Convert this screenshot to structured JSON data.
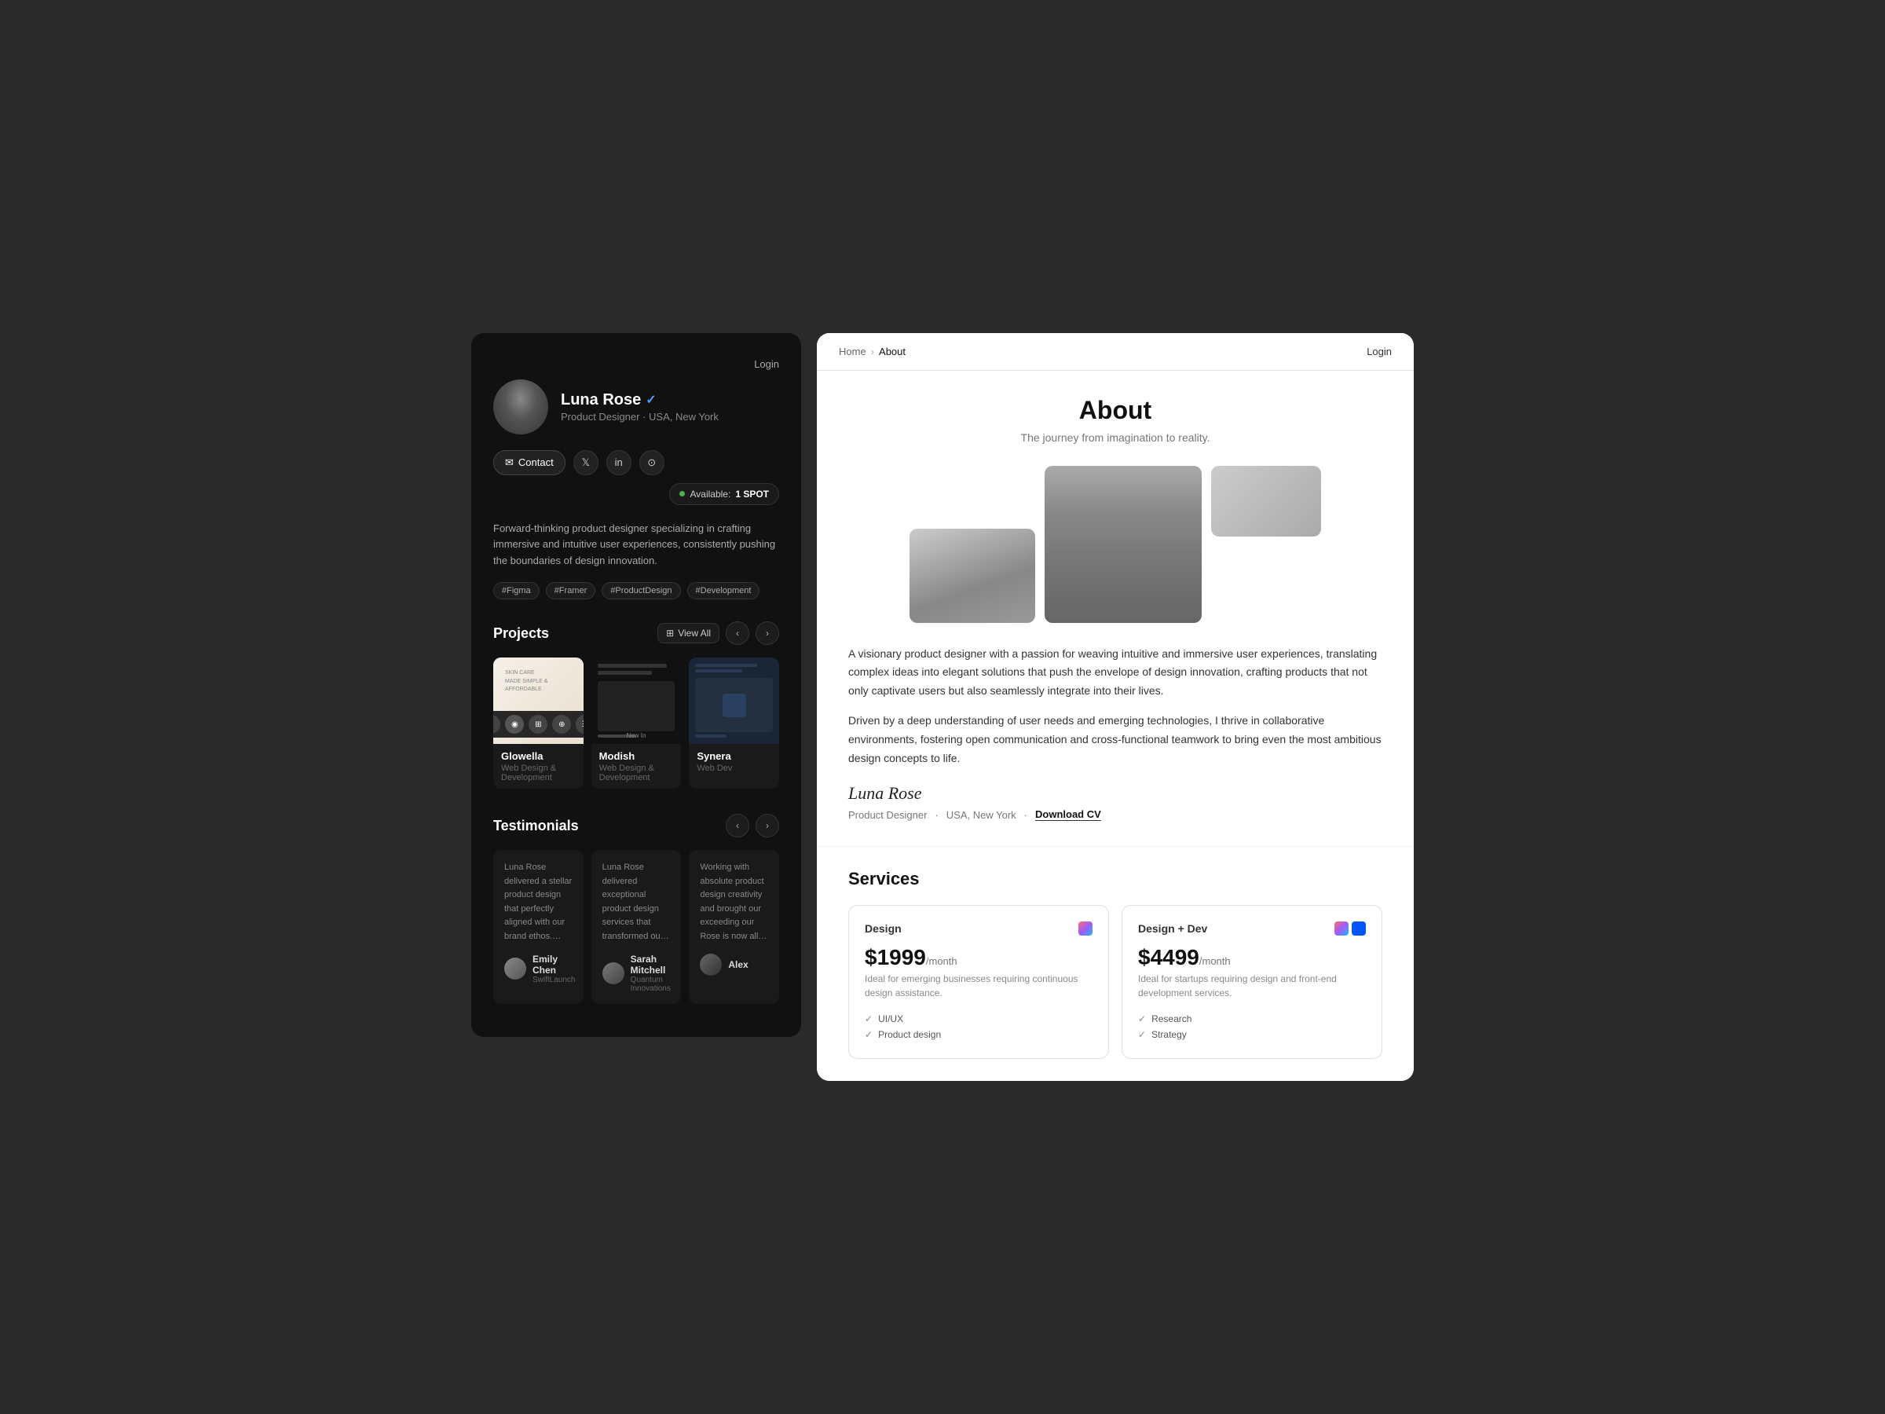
{
  "left_panel": {
    "login_label": "Login",
    "profile": {
      "name": "Luna Rose",
      "verified": true,
      "title": "Product Designer",
      "location": "USA, New York"
    },
    "contact_btn": "Contact",
    "socials": [
      "twitter",
      "linkedin",
      "camera"
    ],
    "availability": {
      "label": "Available:",
      "spots": "1 SPOT"
    },
    "bio": "Forward-thinking product designer specializing in crafting immersive and intuitive user experiences, consistently pushing the boundaries of design innovation.",
    "tags": [
      "#Figma",
      "#Framer",
      "#ProductDesign",
      "#Development"
    ],
    "projects": {
      "title": "Projects",
      "view_all": "View All",
      "items": [
        {
          "name": "Glowella",
          "type": "Web Design & Development",
          "theme": "light"
        },
        {
          "name": "Modish",
          "type": "Web Design & Development",
          "theme": "dark"
        },
        {
          "name": "Synera",
          "type": "Web Dev",
          "theme": "blue"
        }
      ]
    },
    "testimonials": {
      "title": "Testimonials",
      "items": [
        {
          "text": "Luna Rose delivered a stellar product design that perfectly aligned with our brand ethos. Their ability to translate ideas into visually striking designs is commendable. Luna Rose is a reliable and creative partner.",
          "author": "Emily Chen",
          "company": "SwiftLaunch"
        },
        {
          "text": "Luna Rose delivered exceptional product design services that transformed our ideas into reality. Their professionalism and commitment to quality set them apart in the freelance design world.",
          "author": "Sarah Mitchell",
          "company": "Quantum Innovations"
        },
        {
          "text": "Working with absolute product design creativity and brought our exceeding our Rose is now all things de...",
          "author": "Alex",
          "company": ""
        }
      ]
    }
  },
  "right_panel": {
    "nav": {
      "home": "Home",
      "about": "About",
      "login": "Login"
    },
    "about": {
      "title": "About",
      "subtitle": "The journey from imagination to reality."
    },
    "bio_paragraphs": [
      "A visionary product designer with a passion for weaving intuitive and immersive use... ...ating complex ideas into elegan... ...envelope of design innovation, crafting products that not only captivate users but also seamlessly integrate into their lives.",
      "Driven by a deep understanding of user needs and emerging technologies, I thrive in collaborative environments, fostering open communication and cross-functional teamwork to bring even the most ambitious design concepts to life."
    ],
    "signature": "Luna Rose",
    "signature_meta": {
      "title": "Product Designer",
      "location": "USA, New York",
      "cv_label": "Download CV"
    },
    "services": {
      "title": "Services",
      "items": [
        {
          "name": "Design",
          "icons": [
            "figma"
          ],
          "price": "$1999",
          "period": "/month",
          "desc": "Ideal for emerging businesses requiring continuous design assistance.",
          "features": [
            "UI/UX",
            "Product design"
          ]
        },
        {
          "name": "Design + Dev",
          "icons": [
            "figma",
            "framer"
          ],
          "price": "$4499",
          "period": "/month",
          "desc": "Ideal for startups requiring design and front-end development services.",
          "features": [
            "Research",
            "Strategy"
          ]
        }
      ]
    }
  }
}
